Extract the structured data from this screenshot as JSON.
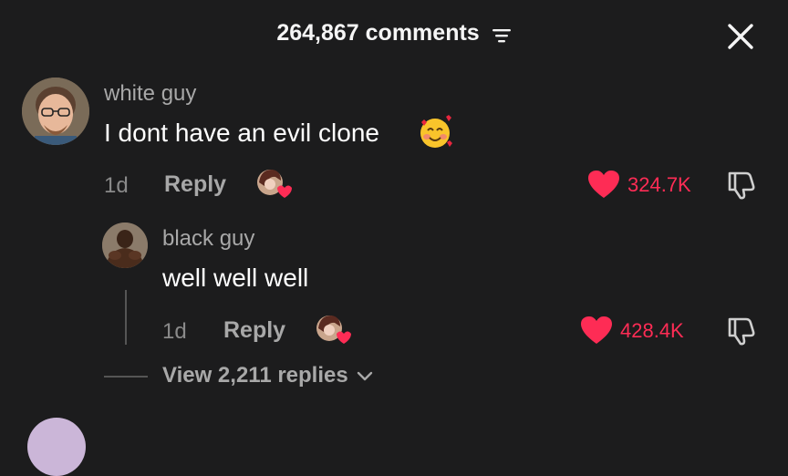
{
  "header": {
    "title": "264,867 comments",
    "filter_icon": "filter-lines-icon",
    "close_icon": "close-x-icon"
  },
  "comments": [
    {
      "username": "white guy",
      "text": "I dont have an evil clone",
      "emoji": "smiling-face-with-hearts",
      "age": "1d",
      "reply_label": "Reply",
      "likes": "324.7K"
    }
  ],
  "replies": [
    {
      "username": "black guy",
      "text": "well well well",
      "age": "1d",
      "reply_label": "Reply",
      "likes": "428.4K"
    }
  ],
  "view_replies": "View 2,211 replies",
  "colors": {
    "background": "#1c1c1d",
    "like": "#fe2c55",
    "secondary_text": "#a8a8a8"
  }
}
